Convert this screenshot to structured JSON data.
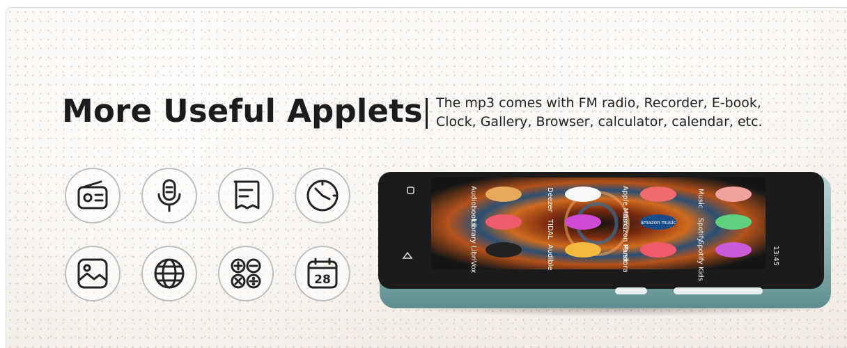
{
  "headline": "More Useful Applets",
  "description": {
    "line1": "The mp3 comes with FM radio, Recorder, E-book,",
    "line2": "Clock, Gallery, Browser, calculator, calendar, etc."
  },
  "icons": [
    {
      "name": "radio-icon"
    },
    {
      "name": "microphone-icon"
    },
    {
      "name": "ebook-icon"
    },
    {
      "name": "clock-icon"
    },
    {
      "name": "gallery-icon"
    },
    {
      "name": "globe-icon"
    },
    {
      "name": "calculator-icon"
    },
    {
      "name": "calendar-icon",
      "text": "28"
    }
  ],
  "device": {
    "body_color": "#8fb7b8",
    "screen_labels": {
      "col1": [
        "Audiobooks",
        "Library",
        "LibriVox"
      ],
      "col2": [
        "Deezer",
        "TIDAL",
        "Audible"
      ],
      "col3": [
        "Apple Music",
        "Amazon Music",
        "Pandora"
      ],
      "col4": [
        "Music",
        "Spotify",
        "Spotify Kids"
      ],
      "status_time": "13:45"
    },
    "app_tile_text": "amazon music"
  }
}
